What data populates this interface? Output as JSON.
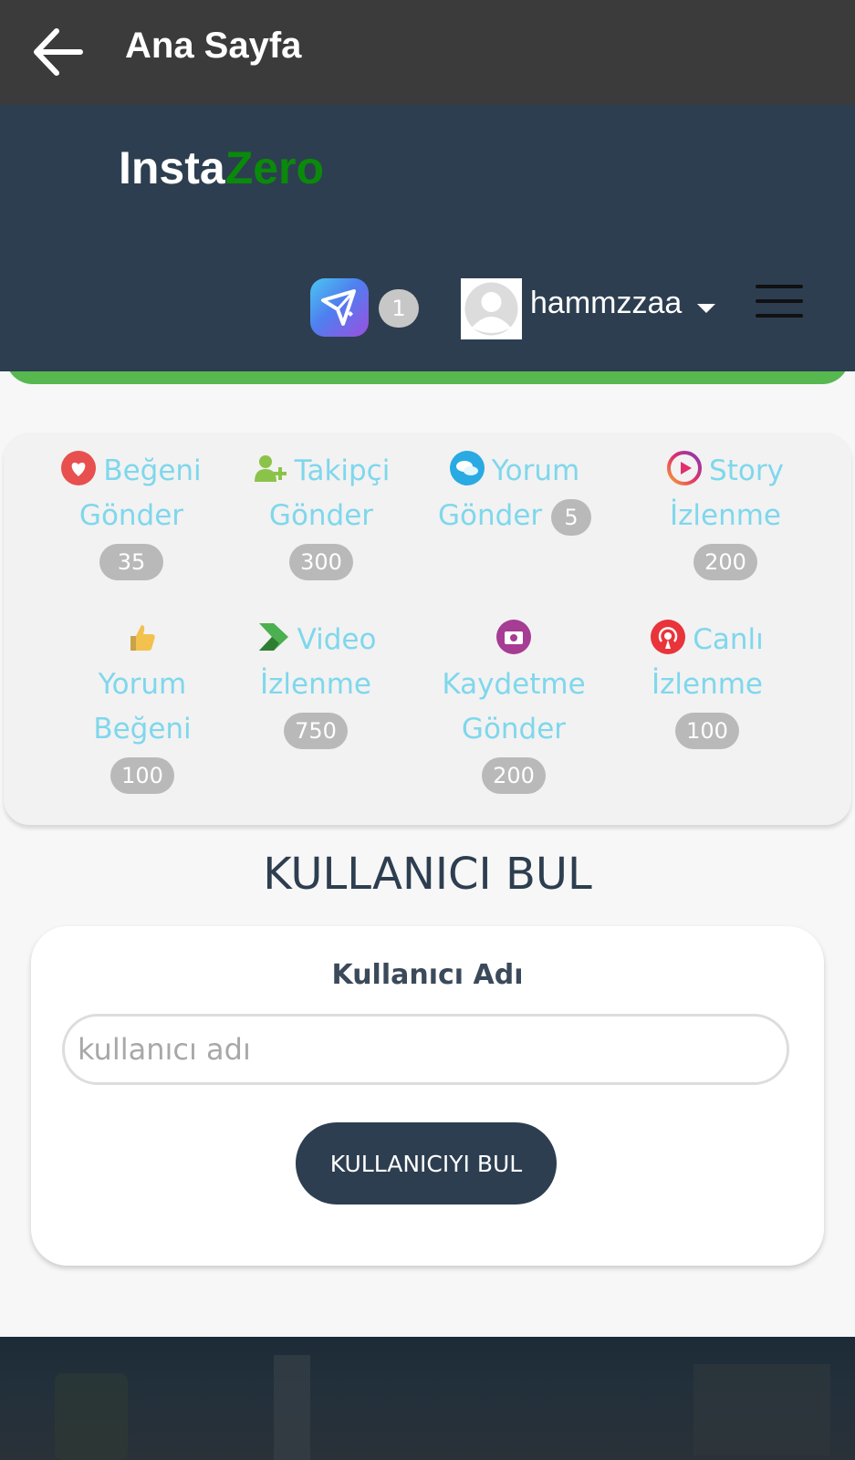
{
  "appbar": {
    "title": "Ana Sayfa"
  },
  "header": {
    "logo_part1": "Insta",
    "logo_part2": "Zero",
    "notification_count": "1",
    "username": "hammzzaa"
  },
  "services": [
    {
      "line1": "Beğeni",
      "line2": "Gönder",
      "count": "35",
      "icon": "heart-icon"
    },
    {
      "line1": "Takipçi",
      "line2": "Gönder",
      "count": "300",
      "icon": "user-plus-icon"
    },
    {
      "line1": "Yorum",
      "line2": "Gönder",
      "count": "5",
      "icon": "comment-icon"
    },
    {
      "line1": "Story",
      "line2": "İzlenme",
      "count": "200",
      "icon": "story-play-icon"
    },
    {
      "line1": "Yorum",
      "line2": "Beğeni",
      "count": "100",
      "icon": "thumbs-up-icon"
    },
    {
      "line1": "Video",
      "line2": "İzlenme",
      "count": "750",
      "icon": "play-arrow-icon"
    },
    {
      "line1": "Kaydetme",
      "line2": "Gönder",
      "count": "200",
      "icon": "camera-icon"
    },
    {
      "line1": "Canlı",
      "line2": "İzlenme",
      "count": "100",
      "icon": "live-broadcast-icon"
    }
  ],
  "find_user": {
    "title": "KULLANICI BUL",
    "label": "Kullanıcı Adı",
    "placeholder": "kullanıcı adı",
    "button": "KULLANICIYI BUL"
  },
  "colors": {
    "appbar": "#3b3b3b",
    "header": "#2d3e50",
    "accent_green": "#56b84f",
    "service_text": "#7fd7ec",
    "badge": "#b9b9b9"
  }
}
